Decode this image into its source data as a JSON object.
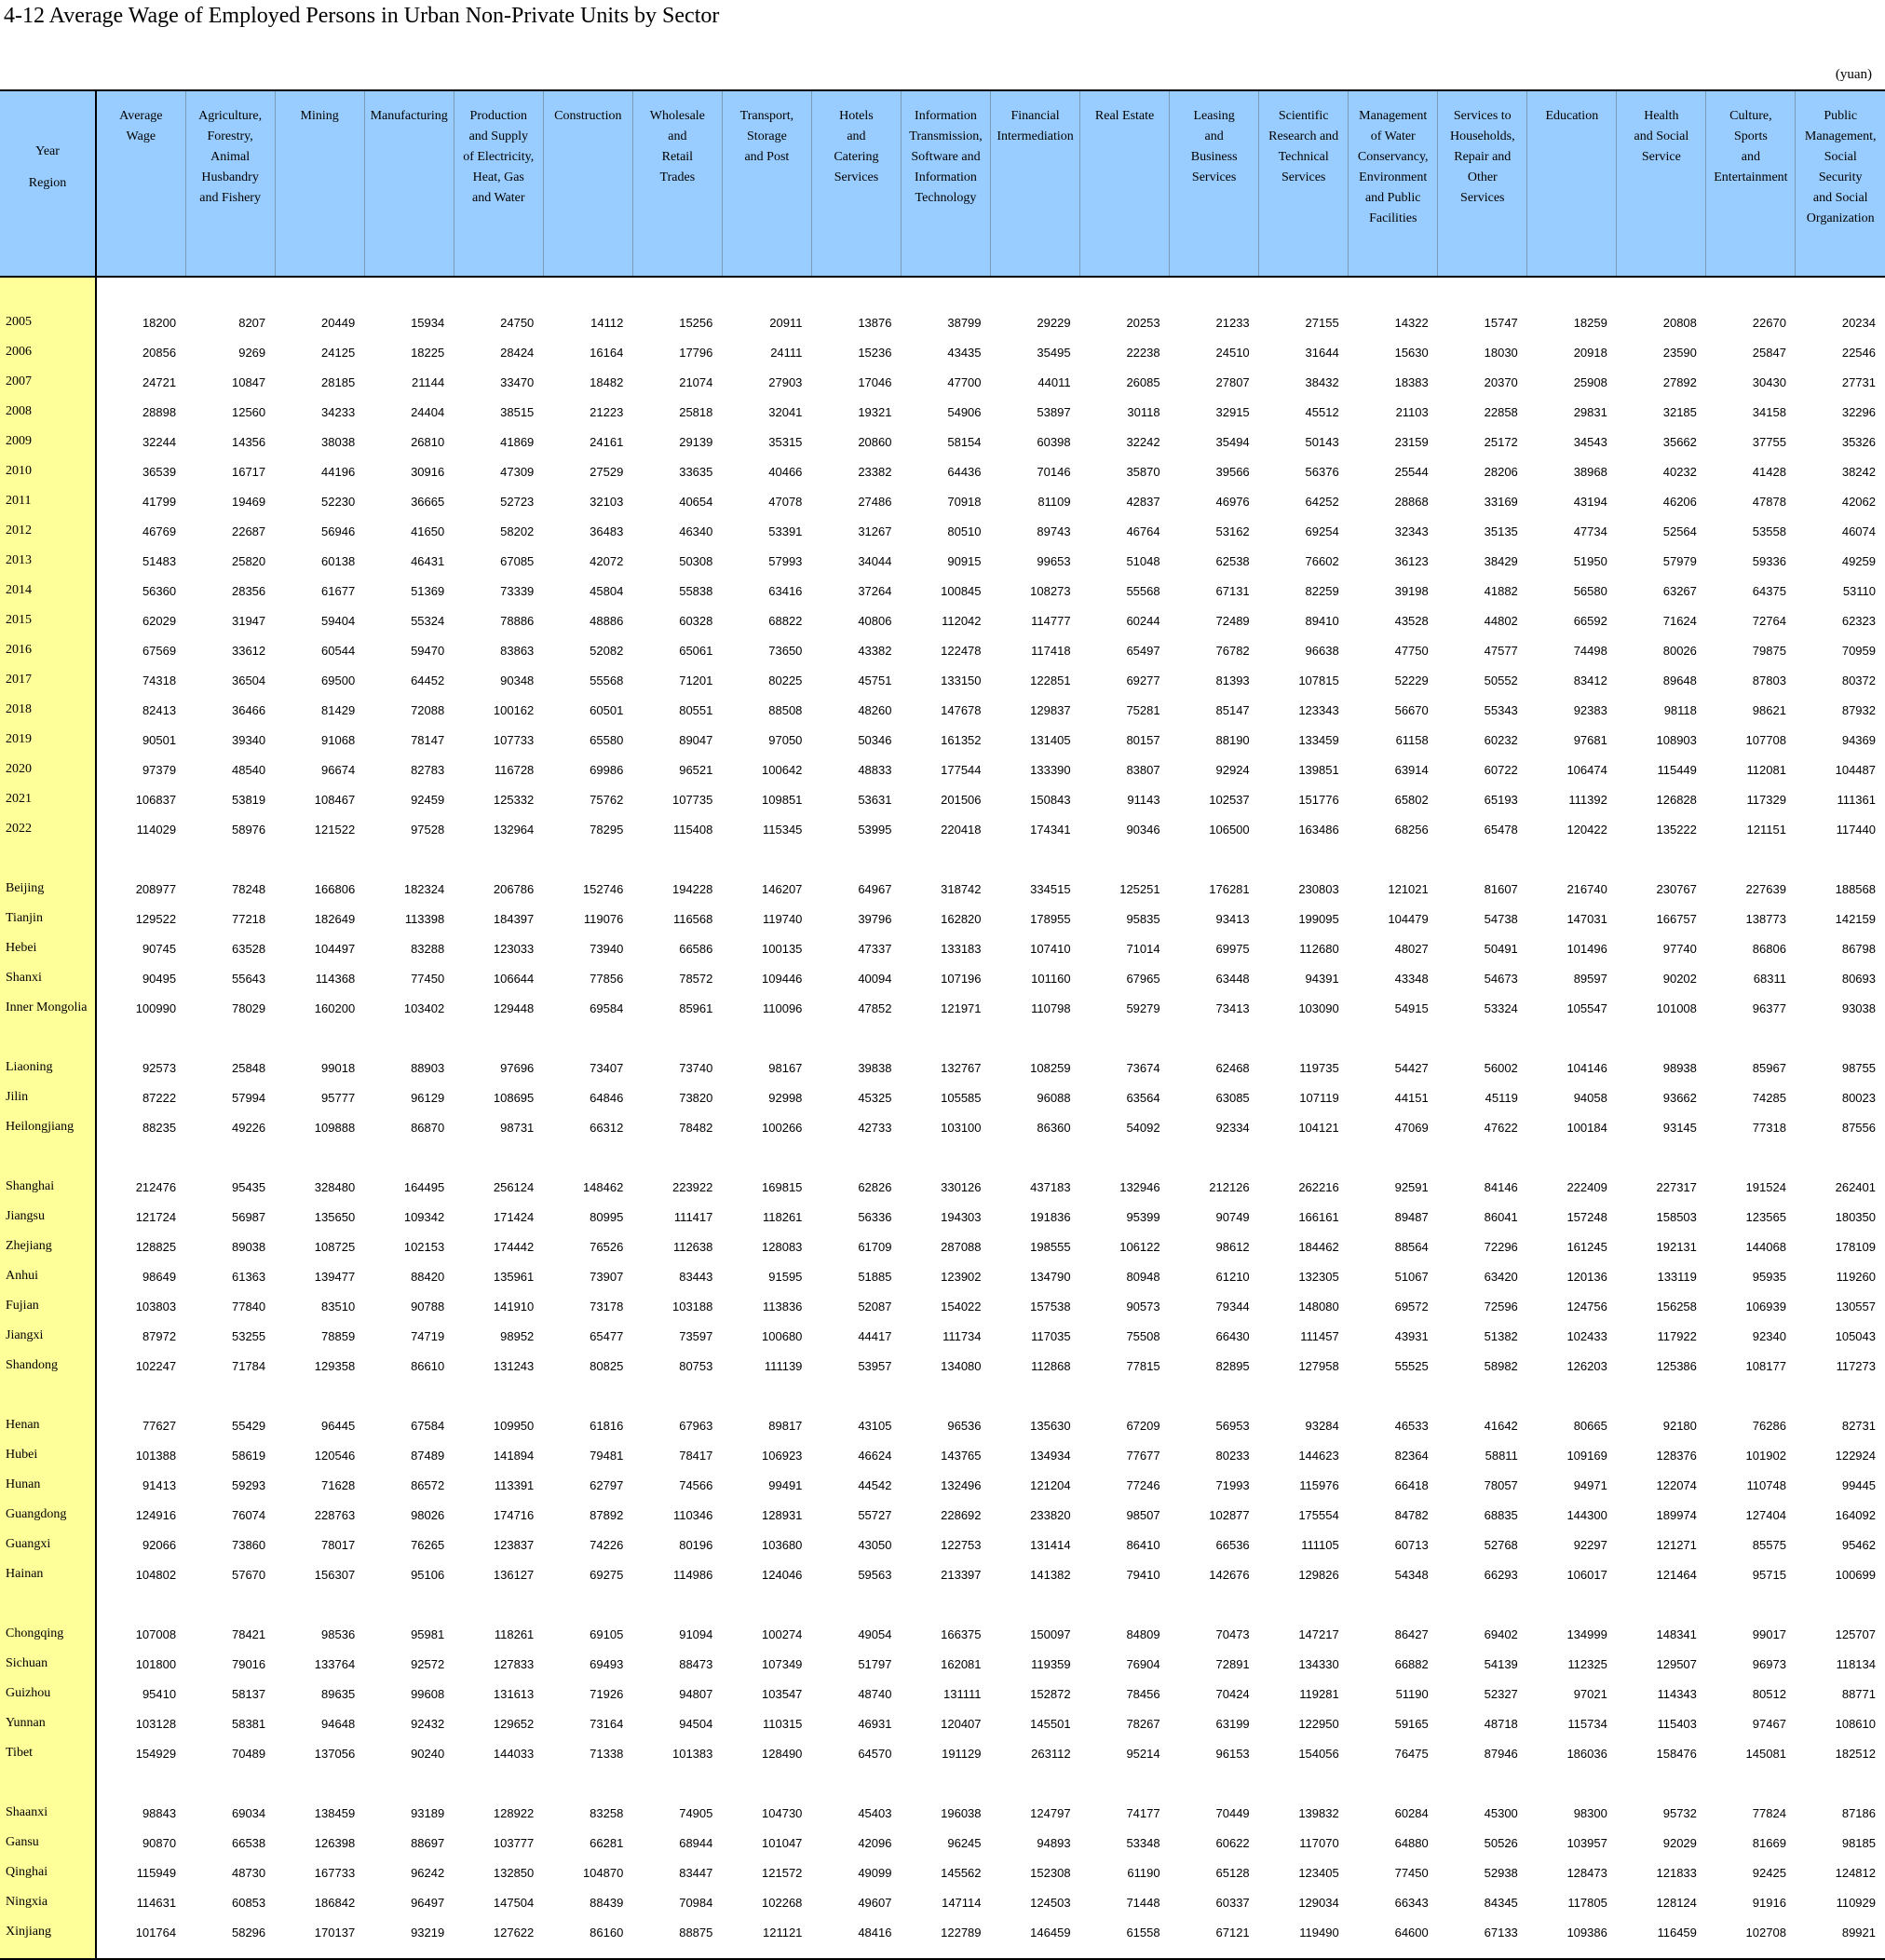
{
  "title": "4-12  Average Wage of Employed Persons in Urban Non-Private Units by Sector",
  "unit": "(yuan)",
  "corner": [
    "Year",
    "Region"
  ],
  "columns": [
    [
      "Average",
      "Wage"
    ],
    [
      "Agriculture,",
      "Forestry,",
      "Animal",
      "Husbandry",
      "and Fishery"
    ],
    [
      "Mining"
    ],
    [
      "Manufacturing"
    ],
    [
      "Production",
      "and Supply",
      "of Electricity,",
      "Heat, Gas",
      "and Water"
    ],
    [
      "Construction"
    ],
    [
      "Wholesale",
      "and",
      "Retail",
      "Trades"
    ],
    [
      "Transport,",
      "Storage",
      "and Post"
    ],
    [
      "Hotels",
      "and",
      "Catering",
      "Services"
    ],
    [
      "Information",
      "Transmission,",
      "Software and",
      "Information",
      "Technology"
    ],
    [
      "Financial",
      "Intermediation"
    ],
    [
      "Real Estate"
    ],
    [
      "Leasing",
      "and",
      "Business",
      "Services"
    ],
    [
      "Scientific",
      "Research and",
      "Technical",
      "Services"
    ],
    [
      "Management",
      "of Water",
      "Conservancy,",
      "Environment",
      "and Public",
      "Facilities"
    ],
    [
      "Services to",
      "Households,",
      "Repair and",
      "Other",
      "Services"
    ],
    [
      "Education"
    ],
    [
      "Health",
      "and Social",
      "Service"
    ],
    [
      "Culture,",
      "Sports",
      "and",
      "Entertainment"
    ],
    [
      "Public",
      "Management,",
      "Social",
      "Security",
      "and Social",
      "Organization"
    ]
  ],
  "groups": [
    [
      [
        "2005",
        18200,
        8207,
        20449,
        15934,
        24750,
        14112,
        15256,
        20911,
        13876,
        38799,
        29229,
        20253,
        21233,
        27155,
        14322,
        15747,
        18259,
        20808,
        22670,
        20234
      ],
      [
        "2006",
        20856,
        9269,
        24125,
        18225,
        28424,
        16164,
        17796,
        24111,
        15236,
        43435,
        35495,
        22238,
        24510,
        31644,
        15630,
        18030,
        20918,
        23590,
        25847,
        22546
      ],
      [
        "2007",
        24721,
        10847,
        28185,
        21144,
        33470,
        18482,
        21074,
        27903,
        17046,
        47700,
        44011,
        26085,
        27807,
        38432,
        18383,
        20370,
        25908,
        27892,
        30430,
        27731
      ],
      [
        "2008",
        28898,
        12560,
        34233,
        24404,
        38515,
        21223,
        25818,
        32041,
        19321,
        54906,
        53897,
        30118,
        32915,
        45512,
        21103,
        22858,
        29831,
        32185,
        34158,
        32296
      ],
      [
        "2009",
        32244,
        14356,
        38038,
        26810,
        41869,
        24161,
        29139,
        35315,
        20860,
        58154,
        60398,
        32242,
        35494,
        50143,
        23159,
        25172,
        34543,
        35662,
        37755,
        35326
      ],
      [
        "2010",
        36539,
        16717,
        44196,
        30916,
        47309,
        27529,
        33635,
        40466,
        23382,
        64436,
        70146,
        35870,
        39566,
        56376,
        25544,
        28206,
        38968,
        40232,
        41428,
        38242
      ],
      [
        "2011",
        41799,
        19469,
        52230,
        36665,
        52723,
        32103,
        40654,
        47078,
        27486,
        70918,
        81109,
        42837,
        46976,
        64252,
        28868,
        33169,
        43194,
        46206,
        47878,
        42062
      ],
      [
        "2012",
        46769,
        22687,
        56946,
        41650,
        58202,
        36483,
        46340,
        53391,
        31267,
        80510,
        89743,
        46764,
        53162,
        69254,
        32343,
        35135,
        47734,
        52564,
        53558,
        46074
      ],
      [
        "2013",
        51483,
        25820,
        60138,
        46431,
        67085,
        42072,
        50308,
        57993,
        34044,
        90915,
        99653,
        51048,
        62538,
        76602,
        36123,
        38429,
        51950,
        57979,
        59336,
        49259
      ],
      [
        "2014",
        56360,
        28356,
        61677,
        51369,
        73339,
        45804,
        55838,
        63416,
        37264,
        100845,
        108273,
        55568,
        67131,
        82259,
        39198,
        41882,
        56580,
        63267,
        64375,
        53110
      ],
      [
        "2015",
        62029,
        31947,
        59404,
        55324,
        78886,
        48886,
        60328,
        68822,
        40806,
        112042,
        114777,
        60244,
        72489,
        89410,
        43528,
        44802,
        66592,
        71624,
        72764,
        62323
      ],
      [
        "2016",
        67569,
        33612,
        60544,
        59470,
        83863,
        52082,
        65061,
        73650,
        43382,
        122478,
        117418,
        65497,
        76782,
        96638,
        47750,
        47577,
        74498,
        80026,
        79875,
        70959
      ],
      [
        "2017",
        74318,
        36504,
        69500,
        64452,
        90348,
        55568,
        71201,
        80225,
        45751,
        133150,
        122851,
        69277,
        81393,
        107815,
        52229,
        50552,
        83412,
        89648,
        87803,
        80372
      ],
      [
        "2018",
        82413,
        36466,
        81429,
        72088,
        100162,
        60501,
        80551,
        88508,
        48260,
        147678,
        129837,
        75281,
        85147,
        123343,
        56670,
        55343,
        92383,
        98118,
        98621,
        87932
      ],
      [
        "2019",
        90501,
        39340,
        91068,
        78147,
        107733,
        65580,
        89047,
        97050,
        50346,
        161352,
        131405,
        80157,
        88190,
        133459,
        61158,
        60232,
        97681,
        108903,
        107708,
        94369
      ],
      [
        "2020",
        97379,
        48540,
        96674,
        82783,
        116728,
        69986,
        96521,
        100642,
        48833,
        177544,
        133390,
        83807,
        92924,
        139851,
        63914,
        60722,
        106474,
        115449,
        112081,
        104487
      ],
      [
        "2021",
        106837,
        53819,
        108467,
        92459,
        125332,
        75762,
        107735,
        109851,
        53631,
        201506,
        150843,
        91143,
        102537,
        151776,
        65802,
        65193,
        111392,
        126828,
        117329,
        111361
      ],
      [
        "2022",
        114029,
        58976,
        121522,
        97528,
        132964,
        78295,
        115408,
        115345,
        53995,
        220418,
        174341,
        90346,
        106500,
        163486,
        68256,
        65478,
        120422,
        135222,
        121151,
        117440
      ]
    ],
    [
      [
        "Beijing",
        208977,
        78248,
        166806,
        182324,
        206786,
        152746,
        194228,
        146207,
        64967,
        318742,
        334515,
        125251,
        176281,
        230803,
        121021,
        81607,
        216740,
        230767,
        227639,
        188568
      ],
      [
        "Tianjin",
        129522,
        77218,
        182649,
        113398,
        184397,
        119076,
        116568,
        119740,
        39796,
        162820,
        178955,
        95835,
        93413,
        199095,
        104479,
        54738,
        147031,
        166757,
        138773,
        142159
      ],
      [
        "Hebei",
        90745,
        63528,
        104497,
        83288,
        123033,
        73940,
        66586,
        100135,
        47337,
        133183,
        107410,
        71014,
        69975,
        112680,
        48027,
        50491,
        101496,
        97740,
        86806,
        86798
      ],
      [
        "Shanxi",
        90495,
        55643,
        114368,
        77450,
        106644,
        77856,
        78572,
        109446,
        40094,
        107196,
        101160,
        67965,
        63448,
        94391,
        43348,
        54673,
        89597,
        90202,
        68311,
        80693
      ],
      [
        "Inner Mongolia",
        100990,
        78029,
        160200,
        103402,
        129448,
        69584,
        85961,
        110096,
        47852,
        121971,
        110798,
        59279,
        73413,
        103090,
        54915,
        53324,
        105547,
        101008,
        96377,
        93038
      ]
    ],
    [
      [
        "Liaoning",
        92573,
        25848,
        99018,
        88903,
        97696,
        73407,
        73740,
        98167,
        39838,
        132767,
        108259,
        73674,
        62468,
        119735,
        54427,
        56002,
        104146,
        98938,
        85967,
        98755
      ],
      [
        "Jilin",
        87222,
        57994,
        95777,
        96129,
        108695,
        64846,
        73820,
        92998,
        45325,
        105585,
        96088,
        63564,
        63085,
        107119,
        44151,
        45119,
        94058,
        93662,
        74285,
        80023
      ],
      [
        "Heilongjiang",
        88235,
        49226,
        109888,
        86870,
        98731,
        66312,
        78482,
        100266,
        42733,
        103100,
        86360,
        54092,
        92334,
        104121,
        47069,
        47622,
        100184,
        93145,
        77318,
        87556
      ]
    ],
    [
      [
        "Shanghai",
        212476,
        95435,
        328480,
        164495,
        256124,
        148462,
        223922,
        169815,
        62826,
        330126,
        437183,
        132946,
        212126,
        262216,
        92591,
        84146,
        222409,
        227317,
        191524,
        262401
      ],
      [
        "Jiangsu",
        121724,
        56987,
        135650,
        109342,
        171424,
        80995,
        111417,
        118261,
        56336,
        194303,
        191836,
        95399,
        90749,
        166161,
        89487,
        86041,
        157248,
        158503,
        123565,
        180350
      ],
      [
        "Zhejiang",
        128825,
        89038,
        108725,
        102153,
        174442,
        76526,
        112638,
        128083,
        61709,
        287088,
        198555,
        106122,
        98612,
        184462,
        88564,
        72296,
        161245,
        192131,
        144068,
        178109
      ],
      [
        "Anhui",
        98649,
        61363,
        139477,
        88420,
        135961,
        73907,
        83443,
        91595,
        51885,
        123902,
        134790,
        80948,
        61210,
        132305,
        51067,
        63420,
        120136,
        133119,
        95935,
        119260
      ],
      [
        "Fujian",
        103803,
        77840,
        83510,
        90788,
        141910,
        73178,
        103188,
        113836,
        52087,
        154022,
        157538,
        90573,
        79344,
        148080,
        69572,
        72596,
        124756,
        156258,
        106939,
        130557
      ],
      [
        "Jiangxi",
        87972,
        53255,
        78859,
        74719,
        98952,
        65477,
        73597,
        100680,
        44417,
        111734,
        117035,
        75508,
        66430,
        111457,
        43931,
        51382,
        102433,
        117922,
        92340,
        105043
      ],
      [
        "Shandong",
        102247,
        71784,
        129358,
        86610,
        131243,
        80825,
        80753,
        111139,
        53957,
        134080,
        112868,
        77815,
        82895,
        127958,
        55525,
        58982,
        126203,
        125386,
        108177,
        117273
      ]
    ],
    [
      [
        "Henan",
        77627,
        55429,
        96445,
        67584,
        109950,
        61816,
        67963,
        89817,
        43105,
        96536,
        135630,
        67209,
        56953,
        93284,
        46533,
        41642,
        80665,
        92180,
        76286,
        82731
      ],
      [
        "Hubei",
        101388,
        58619,
        120546,
        87489,
        141894,
        79481,
        78417,
        106923,
        46624,
        143765,
        134934,
        77677,
        80233,
        144623,
        82364,
        58811,
        109169,
        128376,
        101902,
        122924
      ],
      [
        "Hunan",
        91413,
        59293,
        71628,
        86572,
        113391,
        62797,
        74566,
        99491,
        44542,
        132496,
        121204,
        77246,
        71993,
        115976,
        66418,
        78057,
        94971,
        122074,
        110748,
        99445
      ],
      [
        "Guangdong",
        124916,
        76074,
        228763,
        98026,
        174716,
        87892,
        110346,
        128931,
        55727,
        228692,
        233820,
        98507,
        102877,
        175554,
        84782,
        68835,
        144300,
        189974,
        127404,
        164092
      ],
      [
        "Guangxi",
        92066,
        73860,
        78017,
        76265,
        123837,
        74226,
        80196,
        103680,
        43050,
        122753,
        131414,
        86410,
        66536,
        111105,
        60713,
        52768,
        92297,
        121271,
        85575,
        95462
      ],
      [
        "Hainan",
        104802,
        57670,
        156307,
        95106,
        136127,
        69275,
        114986,
        124046,
        59563,
        213397,
        141382,
        79410,
        142676,
        129826,
        54348,
        66293,
        106017,
        121464,
        95715,
        100699
      ]
    ],
    [
      [
        "Chongqing",
        107008,
        78421,
        98536,
        95981,
        118261,
        69105,
        91094,
        100274,
        49054,
        166375,
        150097,
        84809,
        70473,
        147217,
        86427,
        69402,
        134999,
        148341,
        99017,
        125707
      ],
      [
        "Sichuan",
        101800,
        79016,
        133764,
        92572,
        127833,
        69493,
        88473,
        107349,
        51797,
        162081,
        119359,
        76904,
        72891,
        134330,
        66882,
        54139,
        112325,
        129507,
        96973,
        118134
      ],
      [
        "Guizhou",
        95410,
        58137,
        89635,
        99608,
        131613,
        71926,
        94807,
        103547,
        48740,
        131111,
        152872,
        78456,
        70424,
        119281,
        51190,
        52327,
        97021,
        114343,
        80512,
        88771
      ],
      [
        "Yunnan",
        103128,
        58381,
        94648,
        92432,
        129652,
        73164,
        94504,
        110315,
        46931,
        120407,
        145501,
        78267,
        63199,
        122950,
        59165,
        48718,
        115734,
        115403,
        97467,
        108610
      ],
      [
        "Tibet",
        154929,
        70489,
        137056,
        90240,
        144033,
        71338,
        101383,
        128490,
        64570,
        191129,
        263112,
        95214,
        96153,
        154056,
        76475,
        87946,
        186036,
        158476,
        145081,
        182512
      ]
    ],
    [
      [
        "Shaanxi",
        98843,
        69034,
        138459,
        93189,
        128922,
        83258,
        74905,
        104730,
        45403,
        196038,
        124797,
        74177,
        70449,
        139832,
        60284,
        45300,
        98300,
        95732,
        77824,
        87186
      ],
      [
        "Gansu",
        90870,
        66538,
        126398,
        88697,
        103777,
        66281,
        68944,
        101047,
        42096,
        96245,
        94893,
        53348,
        60622,
        117070,
        64880,
        50526,
        103957,
        92029,
        81669,
        98185
      ],
      [
        "Qinghai",
        115949,
        48730,
        167733,
        96242,
        132850,
        104870,
        83447,
        121572,
        49099,
        145562,
        152308,
        61190,
        65128,
        123405,
        77450,
        52938,
        128473,
        121833,
        92425,
        124812
      ],
      [
        "Ningxia",
        114631,
        60853,
        186842,
        96497,
        147504,
        88439,
        70984,
        102268,
        49607,
        147114,
        124503,
        71448,
        60337,
        129034,
        66343,
        84345,
        117805,
        128124,
        91916,
        110929
      ],
      [
        "Xinjiang",
        101764,
        58296,
        170137,
        93219,
        127622,
        86160,
        88875,
        121121,
        48416,
        122789,
        146459,
        61558,
        67121,
        119490,
        64600,
        67133,
        109386,
        116459,
        102708,
        89921
      ]
    ]
  ]
}
